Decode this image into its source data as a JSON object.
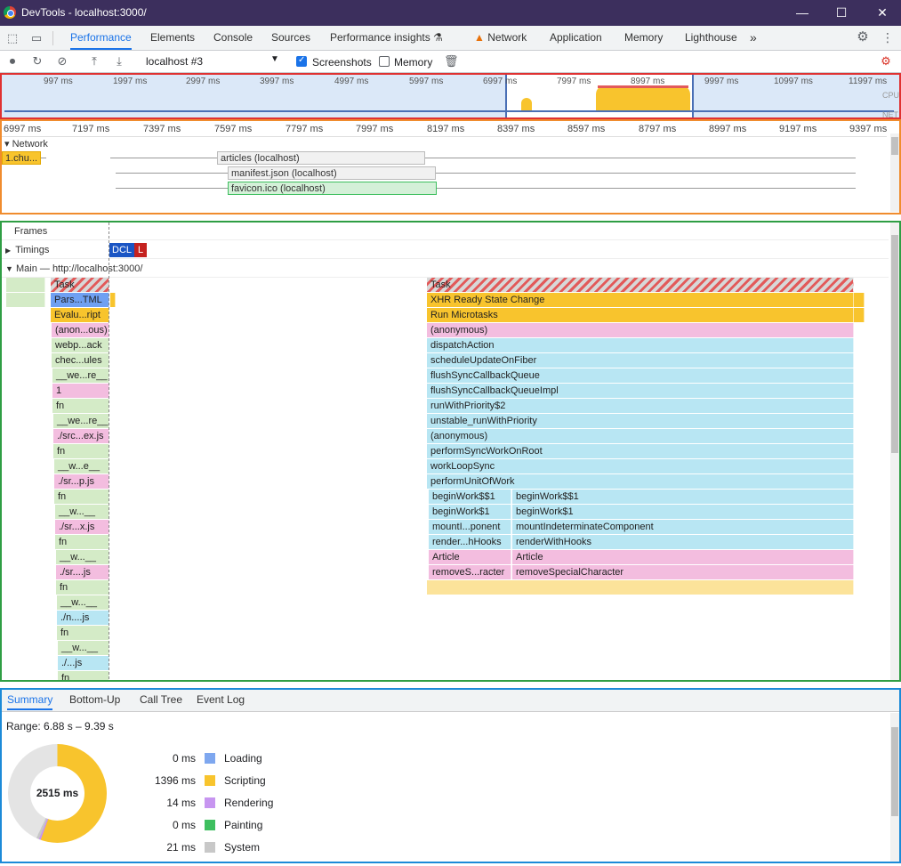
{
  "window": {
    "title": "DevTools - localhost:3000/"
  },
  "tabs": [
    {
      "label": "Performance",
      "active": true
    },
    {
      "label": "Elements"
    },
    {
      "label": "Console"
    },
    {
      "label": "Sources"
    },
    {
      "label": "Performance insights"
    },
    {
      "label": "Network"
    },
    {
      "label": "Application"
    },
    {
      "label": "Memory"
    },
    {
      "label": "Lighthouse"
    }
  ],
  "toolbar": {
    "profile_select": "localhost #3",
    "screenshots_label": "Screenshots",
    "screenshots_checked": true,
    "memory_label": "Memory",
    "memory_checked": false
  },
  "overview": {
    "ticks": [
      "997 ms",
      "1997 ms",
      "2997 ms",
      "3997 ms",
      "4997 ms",
      "5997 ms",
      "6997 ms",
      "7997 ms",
      "8997 ms",
      "9997 ms",
      "10997 ms",
      "11997 ms"
    ],
    "cpu_label": "CPU",
    "net_label": "NET"
  },
  "ruler": {
    "ticks": [
      "6997 ms",
      "7197 ms",
      "7397 ms",
      "7597 ms",
      "7797 ms",
      "7997 ms",
      "8197 ms",
      "8397 ms",
      "8597 ms",
      "8797 ms",
      "8997 ms",
      "9197 ms",
      "9397 ms"
    ]
  },
  "network": {
    "section_label": "Network",
    "requests": [
      "1.chu...",
      "articles (localhost)",
      "manifest.json (localhost)",
      "favicon.ico (localhost)"
    ]
  },
  "tracks": {
    "frames": "Frames",
    "timings": "Timings",
    "dcl": "DCL",
    "l": "L",
    "main": "Main — http://localhost:3000/"
  },
  "flame_left": [
    "Task",
    "Pars...TML",
    "Evalu...ript",
    "(anon...ous)",
    "webp...ack",
    "chec...ules",
    "__we...re__",
    "1",
    "fn",
    "__we...re__",
    "./src...ex.js",
    "fn",
    "__w...e__",
    "./sr...p.js",
    "fn",
    "__w...__",
    "./sr...x.js",
    "fn",
    "__w...__",
    "./sr....js",
    "fn",
    "__w...__",
    "./n....js",
    "fn",
    "__w...__",
    "./...js",
    "fn"
  ],
  "flame_right": [
    "Task",
    "XHR Ready State Change",
    "Run Microtasks",
    "(anonymous)",
    "dispatchAction",
    "scheduleUpdateOnFiber",
    "flushSyncCallbackQueue",
    "flushSyncCallbackQueueImpl",
    "runWithPriority$2",
    "unstable_runWithPriority",
    "(anonymous)",
    "performSyncWorkOnRoot",
    "workLoopSync",
    "performUnitOfWork"
  ],
  "flame_split_left": [
    "beginWork$$1",
    "beginWork$1",
    "mountI...ponent",
    "render...hHooks",
    "Article",
    "removeS...racter"
  ],
  "flame_split_right": [
    "beginWork$$1",
    "beginWork$1",
    "mountIndeterminateComponent",
    "renderWithHooks",
    "Article",
    "removeSpecialCharacter"
  ],
  "summary": {
    "tabs": [
      "Summary",
      "Bottom-Up",
      "Call Tree",
      "Event Log"
    ],
    "range": "Range: 6.88 s – 9.39 s",
    "total": "2515 ms",
    "legend": [
      {
        "ms": "0 ms",
        "label": "Loading",
        "color": "#7ea7ef"
      },
      {
        "ms": "1396 ms",
        "label": "Scripting",
        "color": "#f8c42d"
      },
      {
        "ms": "14 ms",
        "label": "Rendering",
        "color": "#c795f0"
      },
      {
        "ms": "0 ms",
        "label": "Painting",
        "color": "#3ebf5f"
      },
      {
        "ms": "21 ms",
        "label": "System",
        "color": "#c8c8c8"
      }
    ]
  }
}
